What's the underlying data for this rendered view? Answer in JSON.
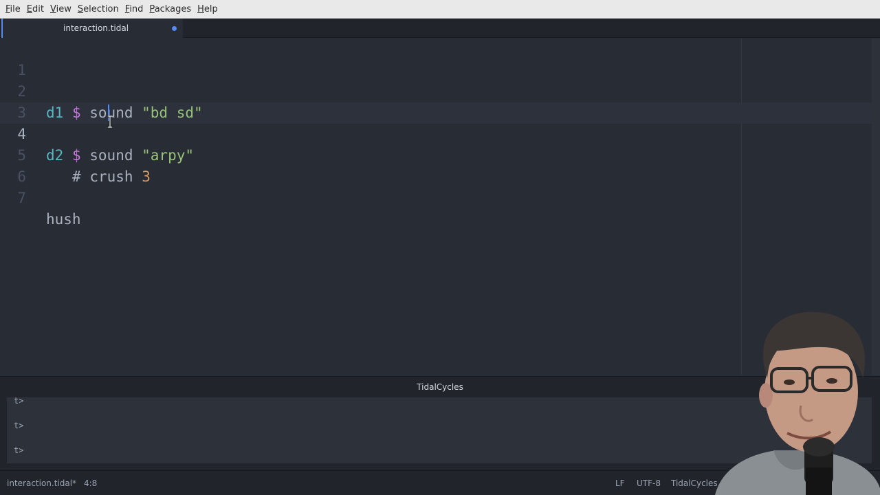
{
  "menubar": {
    "items": [
      {
        "underline": "F",
        "rest": "ile"
      },
      {
        "underline": "E",
        "rest": "dit"
      },
      {
        "underline": "V",
        "rest": "iew"
      },
      {
        "underline": "S",
        "rest": "election"
      },
      {
        "underline": "F",
        "rest": "ind"
      },
      {
        "underline": "P",
        "rest": "ackages"
      },
      {
        "underline": "H",
        "rest": "elp"
      }
    ]
  },
  "tab": {
    "title": "interaction.tidal",
    "modified": true
  },
  "editor": {
    "lines": [
      {
        "number": "1",
        "tokens": []
      },
      {
        "number": "2",
        "tokens": [
          "d1",
          "$",
          "sound",
          "\"bd sd\""
        ]
      },
      {
        "number": "3",
        "tokens": []
      },
      {
        "number": "4",
        "tokens": [
          "d2",
          "$",
          "sound",
          "\"arpy\""
        ]
      },
      {
        "number": "5",
        "tokens": [
          "#",
          "crush",
          "3"
        ]
      },
      {
        "number": "6",
        "tokens": []
      },
      {
        "number": "7",
        "tokens": [
          "hush"
        ]
      }
    ],
    "active_line": "4"
  },
  "panel": {
    "title": "TidalCycles",
    "prompts": [
      "t>",
      "t>",
      "t>"
    ]
  },
  "statusbar": {
    "file": "interaction.tidal*",
    "cursor_position": "4:8",
    "line_ending": "LF",
    "encoding": "UTF-8",
    "grammar": "TidalCycles"
  },
  "colors": {
    "accent": "#568af2",
    "editor_bg": "#282c34",
    "keyword_cyan": "#56b6c2",
    "operator_purple": "#c678dd",
    "string_green": "#98c379",
    "number_orange": "#d19a66"
  }
}
